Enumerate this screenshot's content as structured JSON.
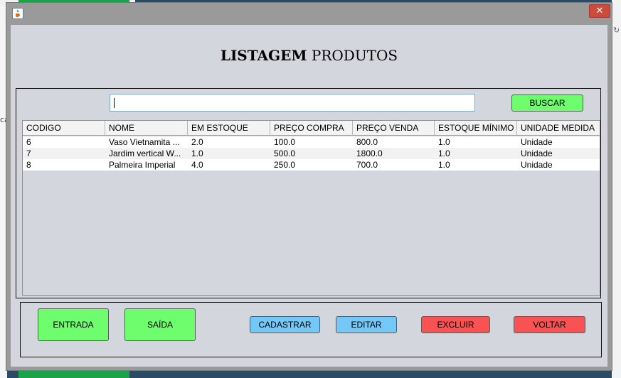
{
  "window": {
    "title": ""
  },
  "heading": {
    "bold": "LISTAGEM",
    "regular": " PRODUTOS"
  },
  "search": {
    "value": "",
    "button": "BUSCAR"
  },
  "table": {
    "columns": [
      "CODIGO",
      "NOME",
      "EM ESTOQUE",
      "PREÇO COMPRA",
      "PREÇO VENDA",
      "ESTOQUE MÍNIMO",
      "UNIDADE MEDIDA"
    ],
    "rows": [
      [
        "6",
        "Vaso Vietnamita ...",
        "2.0",
        "100.0",
        "800.0",
        "1.0",
        "Unidade"
      ],
      [
        "7",
        "Jardim vertical W...",
        "1.0",
        "500.0",
        "1800.0",
        "1.0",
        "Unidade"
      ],
      [
        "8",
        "Palmeira Imperial",
        "4.0",
        "250.0",
        "700.0",
        "1.0",
        "Unidade"
      ]
    ]
  },
  "actions": {
    "entrada": "ENTRADA",
    "saida": "SAÍDA",
    "cadastrar": "CADASTRAR",
    "editar": "EDITAR",
    "excluir": "EXCLUIR",
    "voltar": "VOLTAR"
  },
  "icons": {
    "app": "java-cup-icon",
    "close": "close-icon"
  },
  "colors": {
    "green": "#6dfd6d",
    "blue": "#74c8f8",
    "red": "#f95252"
  }
}
